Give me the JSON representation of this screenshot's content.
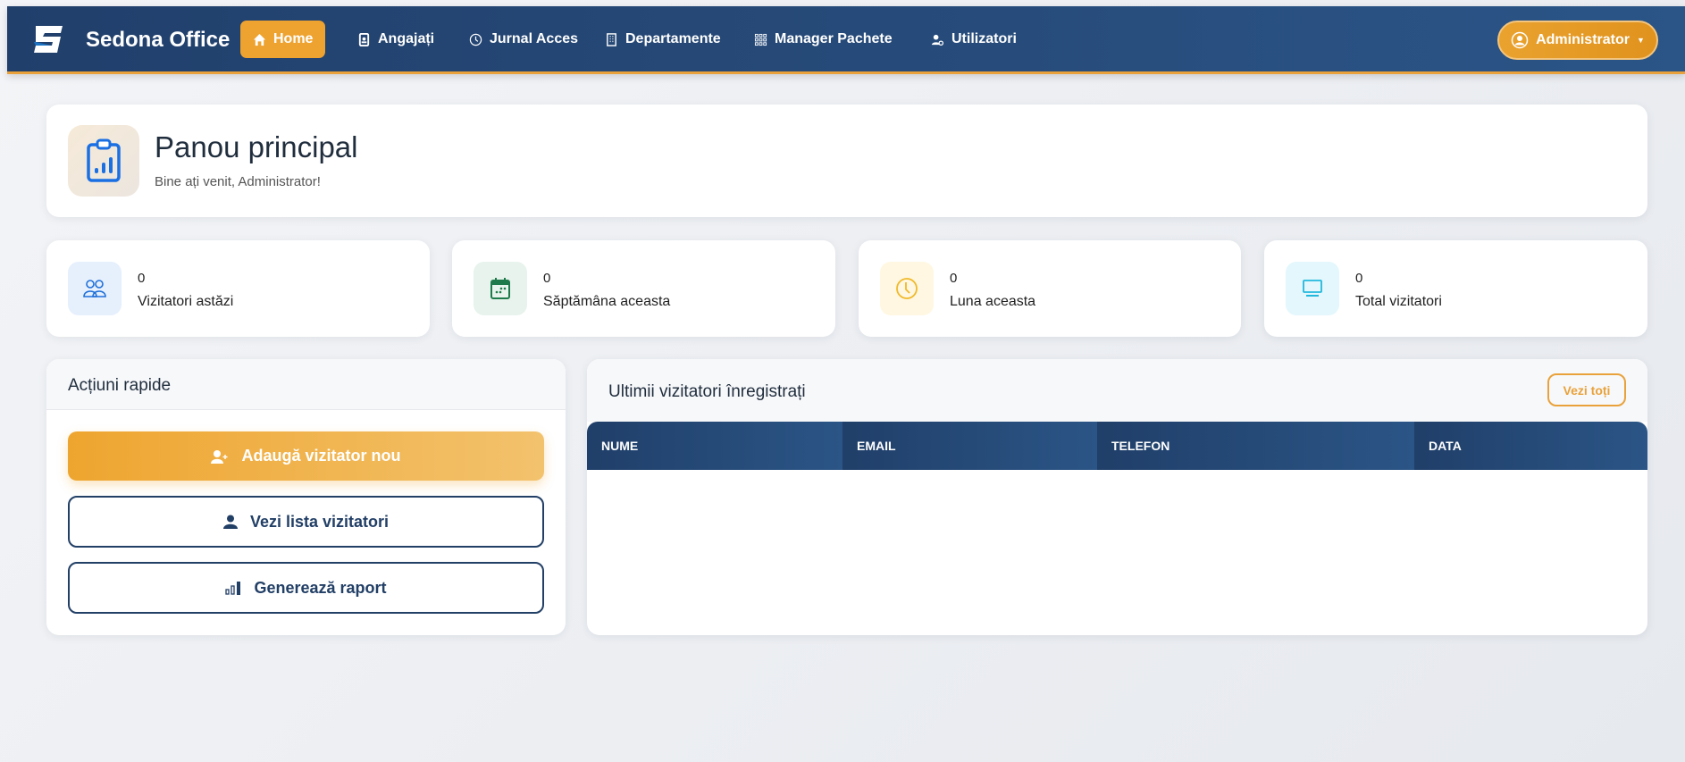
{
  "nav": {
    "brand": "Sedona Office",
    "items": [
      {
        "label": "Home",
        "icon": "home-icon",
        "active": true
      },
      {
        "label": "Angajați",
        "icon": "badge-icon"
      },
      {
        "label": "Jurnal Acces",
        "icon": "clock-icon"
      },
      {
        "label": "Departamente",
        "icon": "building-icon"
      },
      {
        "label": "Manager Pachete",
        "icon": "grid-icon"
      },
      {
        "label": "Utilizatori",
        "icon": "user-gear-icon"
      }
    ],
    "user": "Administrator"
  },
  "header": {
    "title": "Panou principal",
    "subtitle": "Bine ați venit, Administrator!"
  },
  "stats": [
    {
      "value": "0",
      "label": "Vizitatori astăzi",
      "icon": "people-icon",
      "color": "#1e6fd9"
    },
    {
      "value": "0",
      "label": "Săptămâna aceasta",
      "icon": "calendar-icon",
      "color": "#1e7a4a"
    },
    {
      "value": "0",
      "label": "Luna aceasta",
      "icon": "clock-icon",
      "color": "#f0b92a"
    },
    {
      "value": "0",
      "label": "Total vizitatori",
      "icon": "monitor-icon",
      "color": "#22b8dc"
    }
  ],
  "quick": {
    "title": "Acțiuni rapide",
    "buttons": [
      "Adaugă vizitator nou",
      "Vezi lista vizitatori",
      "Generează raport"
    ]
  },
  "recent": {
    "title": "Ultimii vizitatori înregistrați",
    "view_all": "Vezi toți",
    "columns": [
      "NUME",
      "EMAIL",
      "TELEFON",
      "DATA"
    ],
    "rows": []
  }
}
